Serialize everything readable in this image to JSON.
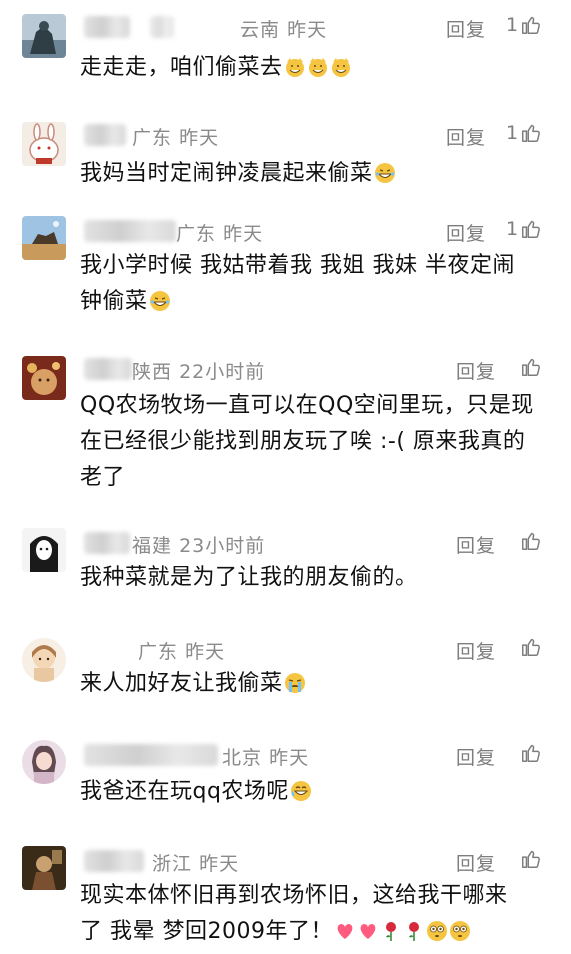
{
  "comments": [
    {
      "location": "云南",
      "time": "昨天",
      "text": "走走走，咱们偷菜去",
      "likes": "1",
      "reply_label": "回复",
      "emoji": [
        "cat-grin-emoji",
        "cat-grin-emoji",
        "cat-grin-emoji"
      ]
    },
    {
      "location": "广东",
      "time": "昨天",
      "text": "我妈当时定闹钟凌晨起来偷菜",
      "likes": "1",
      "reply_label": "回复",
      "emoji": [
        "laugh-emoji"
      ]
    },
    {
      "location": "广东",
      "time": "昨天",
      "text": "我小学时候 我姑带着我 我姐 我妹 半夜定闹钟偷菜",
      "likes": "1",
      "reply_label": "回复",
      "emoji": [
        "laugh-emoji"
      ]
    },
    {
      "location": "陕西",
      "time": "22小时前",
      "text": "QQ农场牧场一直可以在QQ空间里玩，只是现在已经很少能找到朋友玩了唉 :-( 原来我真的老了",
      "likes": "",
      "reply_label": "回复",
      "emoji": []
    },
    {
      "location": "福建",
      "time": "23小时前",
      "text": "我种菜就是为了让我的朋友偷的。",
      "likes": "",
      "reply_label": "回复",
      "emoji": []
    },
    {
      "location": "广东",
      "time": "昨天",
      "text": "来人加好友让我偷菜",
      "likes": "",
      "reply_label": "回复",
      "emoji": [
        "crying-emoji"
      ]
    },
    {
      "location": "北京",
      "time": "昨天",
      "text": "我爸还在玩qq农场呢",
      "likes": "",
      "reply_label": "回复",
      "emoji": [
        "laugh-tear-emoji"
      ]
    },
    {
      "location": "浙江",
      "time": "昨天",
      "text": "现实本体怀旧再到农场怀旧，这给我干哪来了 我晕 梦回2009年了！",
      "likes": "",
      "reply_label": "回复",
      "emoji": [
        "heart-emoji",
        "heart-emoji",
        "rose-emoji",
        "rose-emoji",
        "flushed-emoji",
        "flushed-emoji"
      ]
    }
  ],
  "colors": {
    "text": "#111111",
    "meta": "#8a8a8a",
    "action": "#7d7d7d",
    "background": "#ffffff"
  }
}
